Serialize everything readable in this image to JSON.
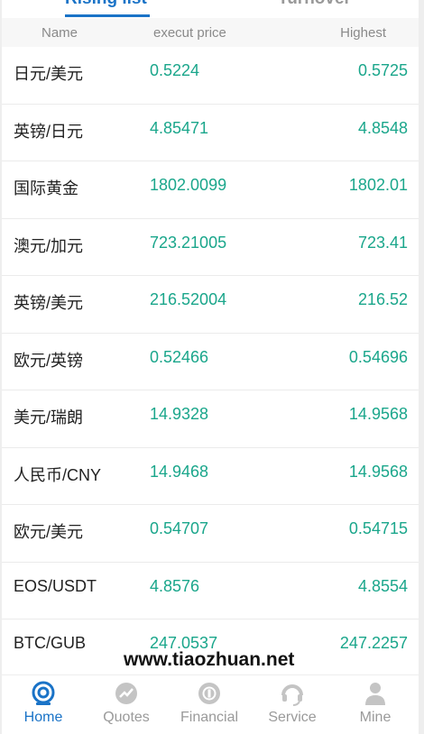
{
  "tabs": [
    {
      "label": "Rising list",
      "active": true
    },
    {
      "label": "Turnover",
      "active": false
    }
  ],
  "table": {
    "columns": [
      "Name",
      "execut price",
      "Highest"
    ],
    "rows": [
      {
        "name": "日元/美元",
        "price": "0.5224",
        "highest": "0.5725"
      },
      {
        "name": "英镑/日元",
        "price": "4.85471",
        "highest": "4.8548"
      },
      {
        "name": "国际黄金",
        "price": "1802.0099",
        "highest": "1802.01"
      },
      {
        "name": "澳元/加元",
        "price": "723.21005",
        "highest": "723.41"
      },
      {
        "name": "英镑/美元",
        "price": "216.52004",
        "highest": "216.52"
      },
      {
        "name": "欧元/英镑",
        "price": "0.52466",
        "highest": "0.54696"
      },
      {
        "name": "美元/瑞朗",
        "price": "14.9328",
        "highest": "14.9568"
      },
      {
        "name": "人民币/CNY",
        "price": "14.9468",
        "highest": "14.9568"
      },
      {
        "name": "欧元/美元",
        "price": "0.54707",
        "highest": "0.54715"
      },
      {
        "name": "EOS/USDT",
        "price": "4.8576",
        "highest": "4.8554"
      },
      {
        "name": "BTC/GUB",
        "price": "247.0537",
        "highest": "247.2257"
      }
    ]
  },
  "watermark": "www.tiaozhuan.net",
  "nav": [
    {
      "label": "Home",
      "icon": "home-icon",
      "active": true
    },
    {
      "label": "Quotes",
      "icon": "quotes-icon",
      "active": false
    },
    {
      "label": "Financial",
      "icon": "financial-icon",
      "active": false
    },
    {
      "label": "Service",
      "icon": "service-icon",
      "active": false
    },
    {
      "label": "Mine",
      "icon": "mine-icon",
      "active": false
    }
  ],
  "colors": {
    "accent": "#1a73c7",
    "price": "#1aa68b",
    "inactive": "#9a9a9a",
    "icon_gray": "#c4c4c4"
  }
}
